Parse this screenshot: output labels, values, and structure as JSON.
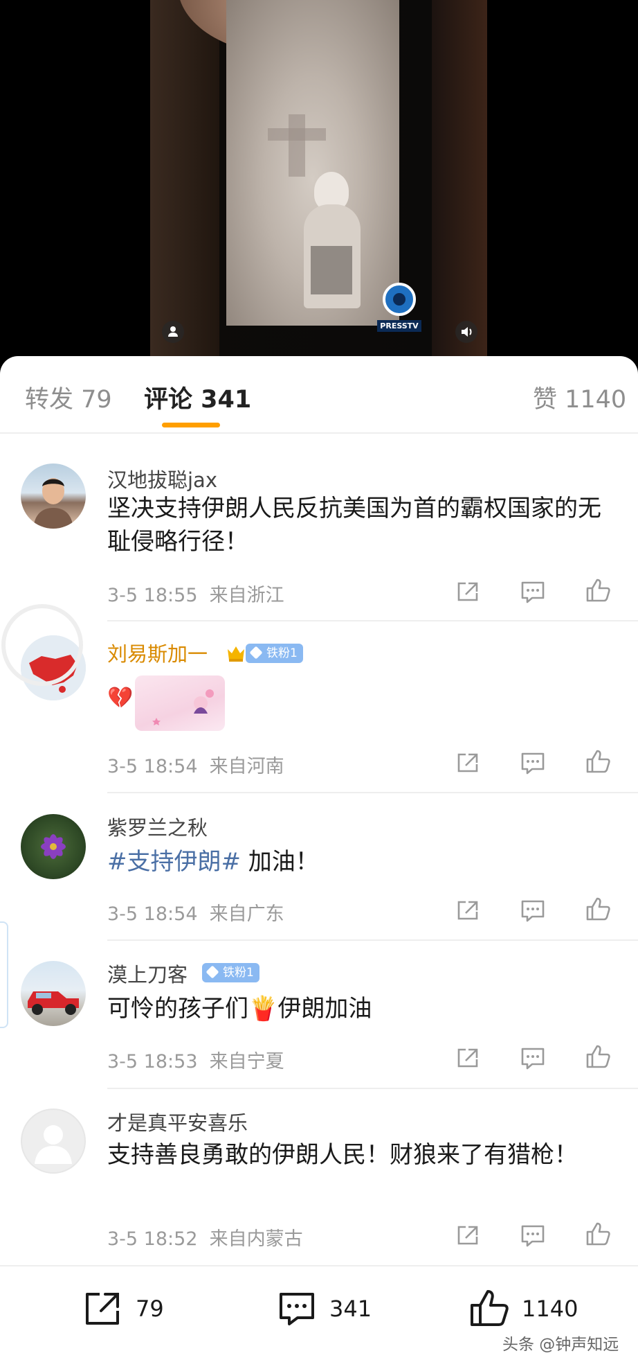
{
  "video": {
    "logo_text": "PRESSTV",
    "left_control_icon": "person-icon",
    "right_control_icon": "volume-icon"
  },
  "tabs": [
    {
      "label": "转发 79"
    },
    {
      "label": "评论 341"
    },
    {
      "label": "赞 1140"
    }
  ],
  "comments": [
    {
      "user": "汉地拔聪jax",
      "text": "坚决支持伊朗人民反抗美国为首的霸权国家的无耻侵略行径！",
      "time": "3-5 18:55",
      "location": "来自浙江"
    },
    {
      "user": "刘易斯加一",
      "badge": "铁粉1",
      "emoji": "💔",
      "time": "3-5 18:54",
      "location": "来自河南"
    },
    {
      "user": "紫罗兰之秋",
      "hashtag": "#支持伊朗#",
      "text": " 加油！",
      "time": "3-5 18:54",
      "location": "来自广东"
    },
    {
      "user": "漠上刀客",
      "badge": "铁粉1",
      "text_before": "可怜的孩子们",
      "emoji": "🍟",
      "text_after": "伊朗加油",
      "time": "3-5 18:53",
      "location": "来自宁夏"
    },
    {
      "user": "才是真平安喜乐",
      "text": "支持善良勇敢的伊朗人民！财狼来了有猎枪！",
      "time": "3-5 18:52",
      "location": "来自内蒙古"
    }
  ],
  "bottom_bar": {
    "repost_count": "79",
    "comment_count": "341",
    "like_count": "1140"
  },
  "watermark": "头条 @钟声知远",
  "colors": {
    "accent": "#ff9f00",
    "vip_name": "#d98a00",
    "hashtag": "#4a6fa5",
    "badge": "#8ab9f2"
  }
}
